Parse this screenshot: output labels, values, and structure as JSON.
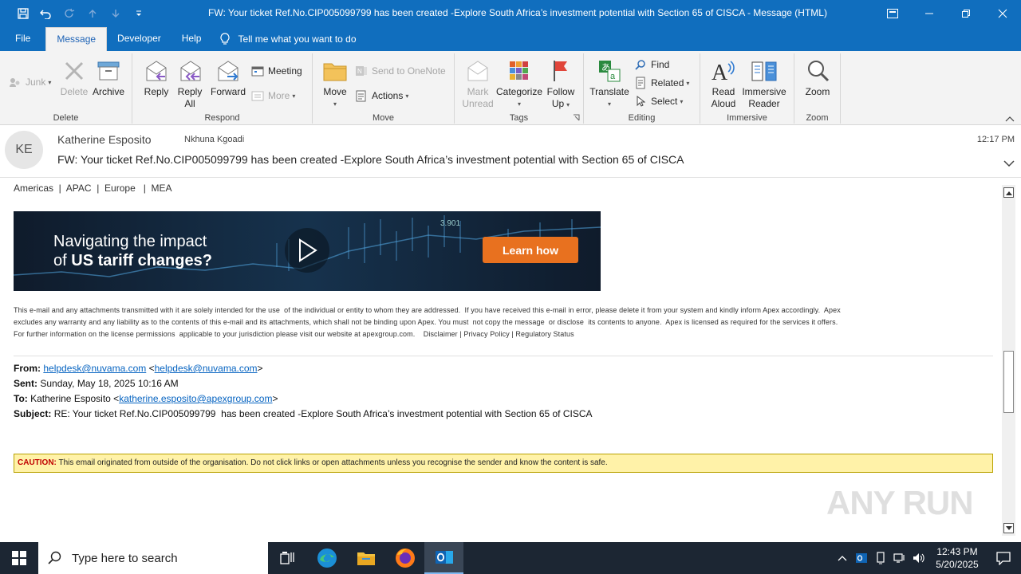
{
  "window": {
    "title": "FW:  Your ticket Ref.No.CIP005099799 has been created -Explore South Africa’s investment potential with Section 65 of CISCA  -  Message (HTML)"
  },
  "tabs": [
    {
      "label": "File"
    },
    {
      "label": "Message",
      "active": true
    },
    {
      "label": "Developer"
    },
    {
      "label": "Help"
    }
  ],
  "tell_me": "Tell me what you want to do",
  "ribbon": {
    "delete_group": {
      "label": "Delete",
      "junk": "Junk",
      "delete": "Delete",
      "archive": "Archive"
    },
    "respond_group": {
      "label": "Respond",
      "reply": "Reply",
      "reply_all_1": "Reply",
      "reply_all_2": "All",
      "forward": "Forward",
      "meeting": "Meeting",
      "more": "More"
    },
    "move_group": {
      "label": "Move",
      "move": "Move",
      "onenote": "Send to OneNote",
      "actions": "Actions"
    },
    "tags_group": {
      "label": "Tags",
      "mark_unread_1": "Mark",
      "mark_unread_2": "Unread",
      "categorize": "Categorize",
      "follow_up_1": "Follow",
      "follow_up_2": "Up"
    },
    "editing_group": {
      "label": "Editing",
      "translate": "Translate",
      "find": "Find",
      "related": "Related",
      "select": "Select"
    },
    "immersive_group": {
      "label": "Immersive",
      "read_aloud_1": "Read",
      "read_aloud_2": "Aloud",
      "immersive_reader_1": "Immersive",
      "immersive_reader_2": "Reader"
    },
    "zoom_group": {
      "label": "Zoom",
      "zoom": "Zoom"
    }
  },
  "message": {
    "avatar_initials": "KE",
    "sender": "Katherine Esposito",
    "recipient": "Nkhuna Kgoadi",
    "time": "12:17 PM",
    "subject": "FW:  Your ticket Ref.No.CIP005099799 has been created -Explore South Africa’s investment potential with Section 65 of CISCA"
  },
  "body": {
    "regions": "Americas  |  APAC  |  Europe   |  MEA",
    "banner": {
      "line1": "Navigating the impact",
      "line2_prefix": "of ",
      "line2_bold": "US tariff changes?",
      "cta": "Learn how",
      "ticker": "3.901"
    },
    "disclaimer_1": "This e-mail and any attachments transmitted with it are solely intended for the use  of the individual or entity to whom they are addressed.  If you have received this e-mail in error, please delete it from your system and kindly inform Apex accordingly.  Apex",
    "disclaimer_2": "excludes any warranty and any liability as to the contents of this e-mail and its attachments, which shall not be binding upon Apex. You must  not copy the message  or disclose  its contents to anyone.  Apex is licensed as required for the services it offers.",
    "disclaimer_3": "For further information on the license permissions  applicable to your jurisdiction please visit our website at apexgroup.com.    Disclaimer | Privacy Policy | Regulatory Status",
    "forwarded": {
      "from_label": "From:",
      "from_email": "helpdesk@nuvama.com",
      "sent_label": "Sent:",
      "sent_value": "Sunday, May 18, 2025 10:16 AM",
      "to_label": "To:",
      "to_name": "Katherine Esposito",
      "to_email": "katherine.esposito@apexgroup.com",
      "subject_label": "Subject:",
      "subject_value": "RE: Your ticket Ref.No.CIP005099799  has been created -Explore South Africa’s investment potential with Section 65 of CISCA"
    },
    "caution_label": "CAUTION:",
    "caution_text": " This email originated from outside of the organisation.  Do not click links or open attachments unless you recognise the sender and know the content is safe."
  },
  "watermark": "ANY RUN",
  "taskbar": {
    "search_placeholder": "Type here to search",
    "time": "12:43 PM",
    "date": "5/20/2025"
  }
}
